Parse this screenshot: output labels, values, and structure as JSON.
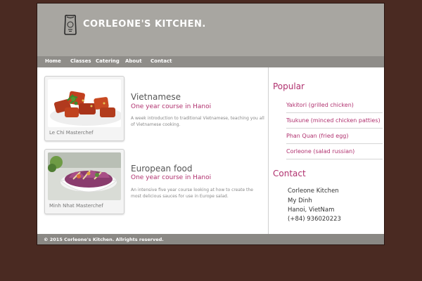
{
  "header": {
    "logo_icon": "rice-bag-icon",
    "title": "CORLEONE'S KITCHEN."
  },
  "nav": {
    "items": [
      "Home",
      "Classes",
      "Catering",
      "About",
      "Contact"
    ]
  },
  "courses": [
    {
      "title": "Vietnamese",
      "subtitle": "One year course in Hanoi",
      "description": "A week introduction to traditional Vietnamese, teaching you all of Vietnamese cooking.",
      "chef": "Le Chi Masterchef",
      "image": "fried-chicken-dish"
    },
    {
      "title": "European food",
      "subtitle": "One year course in Hanoi",
      "description": "An intensive five year course looking at how to create the most delicious sauces for use in Europe salad.",
      "chef": "Minh Nhat Masterchef",
      "image": "salad-bowl"
    }
  ],
  "sidebar": {
    "popular_heading": "Popular",
    "popular_items": [
      "Yakitori (grilled chicken)",
      "Tsukune (minced chicken patties)",
      "Phan Quan (fried egg)",
      "Corleone (salad russian)"
    ],
    "contact_heading": "Contact",
    "contact_lines": [
      "Corleone Kitchen",
      "My Dinh",
      "Hanoi, VietNam",
      "(+84) 936020223"
    ]
  },
  "footer": {
    "text": "© 2015 Corleone's Kitchen. Allrights reserved."
  },
  "colors": {
    "page_bg": "#4a2a22",
    "header_bg": "#a8a6a1",
    "nav_bg": "#8f8d89",
    "accent": "#b0306e"
  }
}
